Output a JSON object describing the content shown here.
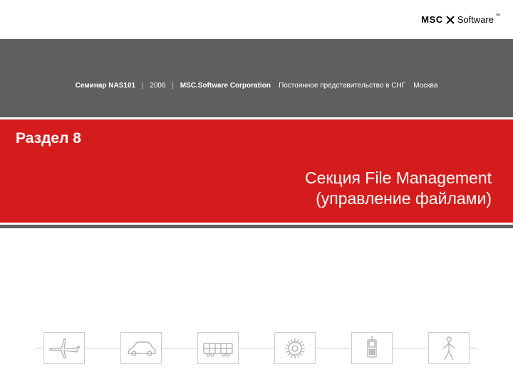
{
  "logo": {
    "part1": "MSC",
    "part2": "Software"
  },
  "meta": {
    "seminar": "Семинар NAS101",
    "year": "2006",
    "company": "MSC.Software Corporation",
    "rep": "Постоянное представительство в СНГ",
    "city": "Москва"
  },
  "section": {
    "label": "Раздел 8",
    "title_line1": "Секция File Management",
    "title_line2": "(управление файлами)"
  },
  "icons": [
    "airplane-icon",
    "car-icon",
    "bus-icon",
    "gear-icon",
    "phone-icon",
    "person-icon"
  ]
}
